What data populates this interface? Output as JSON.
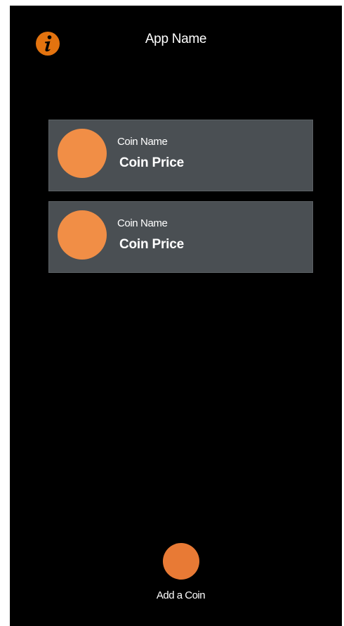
{
  "header": {
    "title": "App Name",
    "info_icon": "info-icon"
  },
  "coins": [
    {
      "name": "Coin Name",
      "price": "Coin Price"
    },
    {
      "name": "Coin Name",
      "price": "Coin Price"
    }
  ],
  "footer": {
    "add_label": "Add a Coin"
  },
  "colors": {
    "background": "#000000",
    "card": "#4a4f53",
    "accent": "#f18e46",
    "add_button": "#e87a35",
    "info_icon": "#e3730f",
    "text": "#ffffff"
  }
}
